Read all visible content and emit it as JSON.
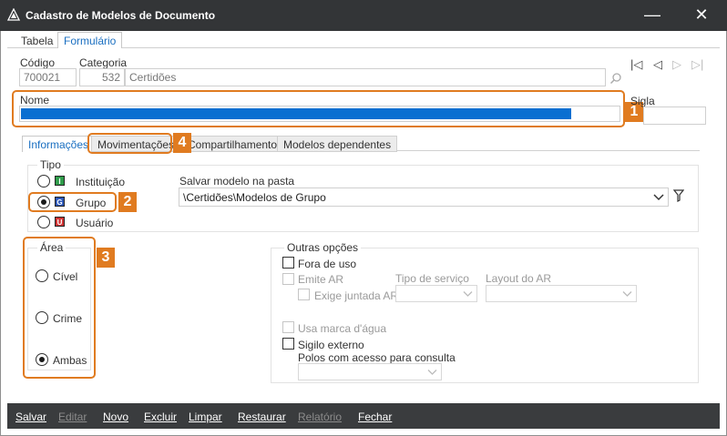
{
  "window": {
    "title": "Cadastro de Modelos de Documento",
    "minimize_glyph": "—",
    "close_glyph": "✕"
  },
  "main_tabs": [
    {
      "label": "Tabela"
    },
    {
      "label": "Formulário"
    }
  ],
  "fields": {
    "codigo_label": "Código",
    "codigo_value": "700021",
    "categoria_label": "Categoria",
    "categoria_code": "532",
    "categoria_name": "Certidões",
    "nome_label": "Nome",
    "sigla_label": "Sigla"
  },
  "nav_glyphs": {
    "first": "|◁",
    "prev": "◁",
    "next": "▷",
    "last": "▷|"
  },
  "callouts": [
    "1",
    "2",
    "3",
    "4"
  ],
  "sub_tabs": [
    {
      "label": "Informações"
    },
    {
      "label": "Movimentações"
    },
    {
      "label": "Compartilhamentos"
    },
    {
      "label": "Modelos dependentes"
    }
  ],
  "tipo": {
    "title": "Tipo",
    "options": [
      {
        "label": "Instituição",
        "badge": "I",
        "color": "#2e9c4a",
        "checked": false
      },
      {
        "label": "Grupo",
        "badge": "G",
        "color": "#2d58b8",
        "checked": true
      },
      {
        "label": "Usuário",
        "badge": "U",
        "color": "#d03434",
        "checked": false
      }
    ]
  },
  "pasta": {
    "label": "Salvar modelo na pasta",
    "value": "\\Certidões\\Modelos de Grupo"
  },
  "area": {
    "title": "Área",
    "options": [
      {
        "label": "Cível",
        "checked": false
      },
      {
        "label": "Crime",
        "checked": false
      },
      {
        "label": "Ambas",
        "checked": true
      }
    ]
  },
  "outras": {
    "title": "Outras opções",
    "fora_de_uso": "Fora de uso",
    "emite_ar": "Emite AR",
    "exige_juntada": "Exige juntada AR",
    "tipo_servico": "Tipo de serviço",
    "layout_ar": "Layout do AR",
    "marca_agua": "Usa marca d'água",
    "sigilo": "Sigilo externo",
    "polos": "Polos com acesso para consulta"
  },
  "bottom_buttons": [
    {
      "label": "Salvar",
      "enabled": true
    },
    {
      "label": "Editar",
      "enabled": false
    },
    {
      "label": "Novo",
      "enabled": true
    },
    {
      "label": "Excluir",
      "enabled": true
    },
    {
      "label": "Limpar",
      "enabled": true
    },
    {
      "label": "Restaurar",
      "enabled": true
    },
    {
      "label": "Relatório",
      "enabled": false
    },
    {
      "label": "Fechar",
      "enabled": true
    }
  ],
  "colors": {
    "accent": "#e07b20",
    "selection": "#0a6fd1",
    "titlebar": "#333537"
  }
}
